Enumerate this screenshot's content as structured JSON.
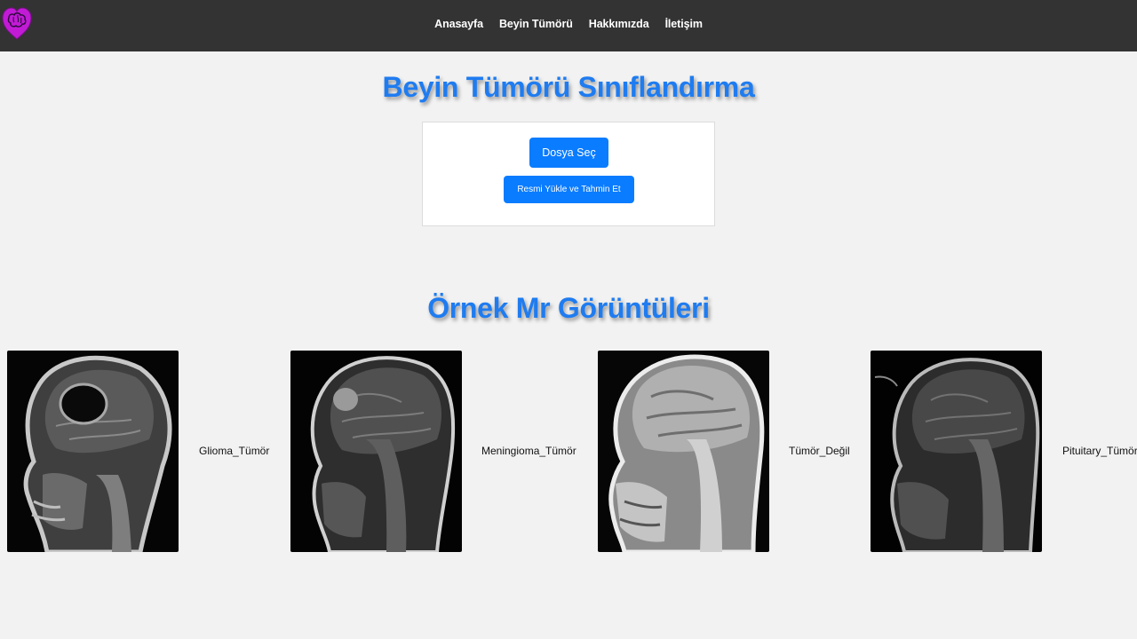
{
  "nav": {
    "links": [
      "Anasayfa",
      "Beyin Tümörü",
      "Hakkımızda",
      "İletişim"
    ]
  },
  "main": {
    "title": "Beyin Tümörü Sınıflandırma",
    "file_button": "Dosya Seç",
    "predict_button": "Resmi Yükle ve Tahmin Et"
  },
  "samples": {
    "title": "Örnek Mr Görüntüleri",
    "items": [
      {
        "label": "Glioma_Tümör"
      },
      {
        "label": "Meningioma_Tümör"
      },
      {
        "label": "Tümör_Değil"
      },
      {
        "label": "Pituitary_Tümör"
      }
    ]
  },
  "colors": {
    "navbar": "#333333",
    "accent": "#1f7cf0",
    "button": "#0a7cff",
    "background": "#f2f2f2",
    "logo": "#c21bd6"
  },
  "icons": {
    "logo": "brain-heart-icon"
  }
}
